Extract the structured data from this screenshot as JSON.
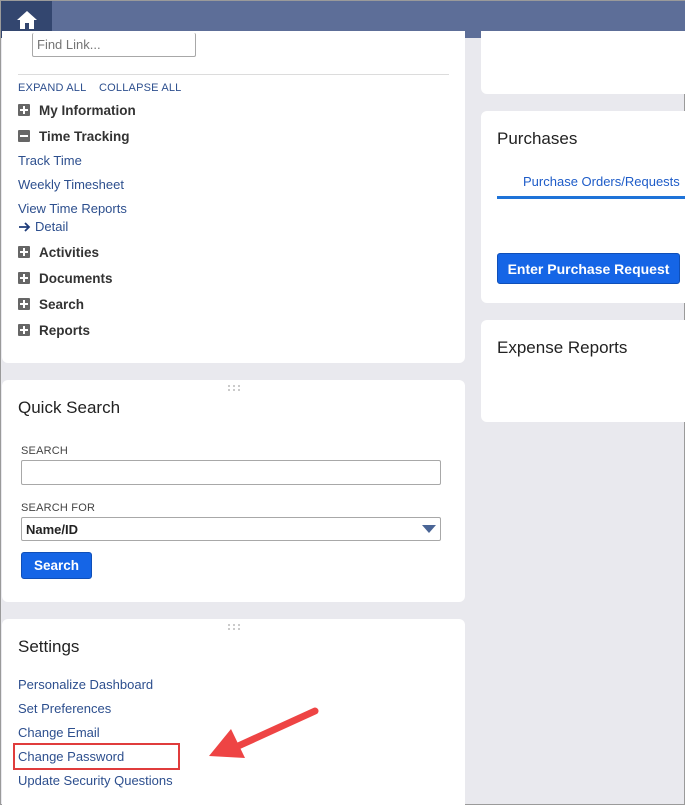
{
  "topbar": {
    "home_icon": "home-icon"
  },
  "nav": {
    "find_link_placeholder": "Find Link...",
    "expand_all": "EXPAND ALL",
    "collapse_all": "COLLAPSE ALL",
    "sections": [
      {
        "label": "My Information",
        "state": "collapsed"
      },
      {
        "label": "Time Tracking",
        "state": "expanded"
      },
      {
        "label": "Activities",
        "state": "collapsed"
      },
      {
        "label": "Documents",
        "state": "collapsed"
      },
      {
        "label": "Search",
        "state": "collapsed"
      },
      {
        "label": "Reports",
        "state": "collapsed"
      }
    ],
    "time_tracking_links": [
      "Track Time",
      "Weekly Timesheet",
      "View Time Reports"
    ],
    "detail_link": "Detail"
  },
  "quick_search": {
    "title": "Quick Search",
    "search_label": "SEARCH",
    "search_value": "",
    "search_for_label": "SEARCH FOR",
    "search_for_value": "Name/ID",
    "button": "Search"
  },
  "settings": {
    "title": "Settings",
    "links": [
      "Personalize Dashboard",
      "Set Preferences",
      "Change Email",
      "Change Password",
      "Update Security Questions"
    ]
  },
  "purchases": {
    "title": "Purchases",
    "tab": "Purchase Orders/Requests",
    "button": "Enter Purchase Request"
  },
  "expense_reports": {
    "title": "Expense Reports"
  },
  "colors": {
    "accent": "#1565e6",
    "topbar": "#5d6e98",
    "highlight": "#e03c3c"
  }
}
